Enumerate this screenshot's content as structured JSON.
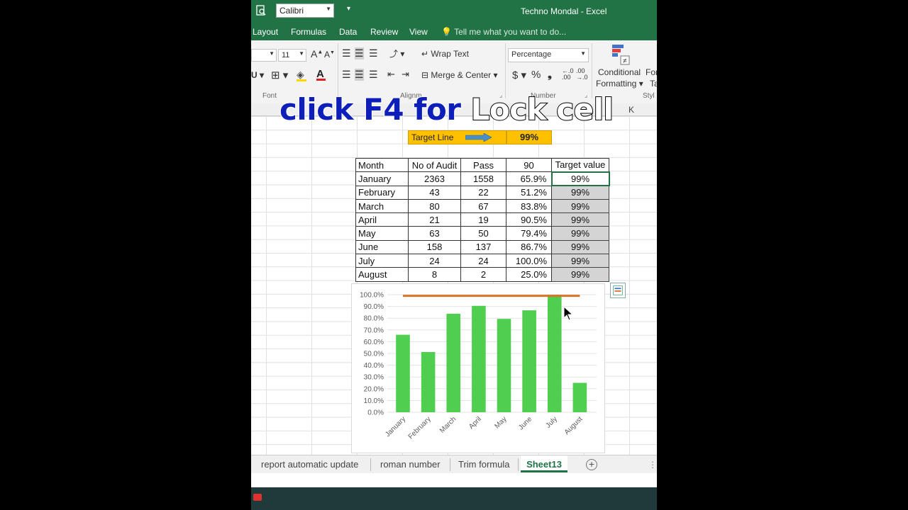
{
  "window": {
    "title": "Techno Mondal - Excel"
  },
  "quick_access": {
    "font_name": "Calibri",
    "more": "▾"
  },
  "menu": {
    "tabs": [
      "Layout",
      "Formulas",
      "Data",
      "Review",
      "View"
    ],
    "tell_me": "Tell me what you want to do..."
  },
  "ribbon": {
    "font_size": "11",
    "wrap_text": "Wrap Text",
    "merge_center": "Merge & Center",
    "number_format": "Percentage",
    "currency": "$",
    "percent": "%",
    "comma": "❟",
    "conditional_formatting_1": "Conditional",
    "conditional_formatting_2": "Formatting",
    "format_as_1": "For",
    "format_as_2": "Ta",
    "font_group": "Font",
    "alignment_group": "Alignm",
    "number_group": "Number",
    "styles_group": "Styl"
  },
  "caption": {
    "part1": "click F4 for",
    "part2": "Lock cell"
  },
  "column_header": "K",
  "target": {
    "label": "Target Line",
    "value": "99%"
  },
  "table": {
    "headers": [
      "Month",
      "No of Audit",
      "Pass",
      "90",
      "Target value"
    ],
    "rows": [
      [
        "January",
        "2363",
        "1558",
        "65.9%",
        "99%"
      ],
      [
        "February",
        "43",
        "22",
        "51.2%",
        "99%"
      ],
      [
        "March",
        "80",
        "67",
        "83.8%",
        "99%"
      ],
      [
        "April",
        "21",
        "19",
        "90.5%",
        "99%"
      ],
      [
        "May",
        "63",
        "50",
        "79.4%",
        "99%"
      ],
      [
        "June",
        "158",
        "137",
        "86.7%",
        "99%"
      ],
      [
        "July",
        "24",
        "24",
        "100.0%",
        "99%"
      ],
      [
        "August",
        "8",
        "2",
        "25.0%",
        "99%"
      ]
    ]
  },
  "chart_data": {
    "type": "bar",
    "categories": [
      "January",
      "February",
      "March",
      "April",
      "May",
      "June",
      "July",
      "August"
    ],
    "series": [
      {
        "values": [
          65.9,
          51.2,
          83.8,
          90.5,
          79.4,
          86.7,
          100.0,
          25.0
        ],
        "color": "#4fce4f"
      },
      {
        "values": [
          99,
          99,
          99,
          99,
          99,
          99,
          99,
          99
        ],
        "color": "#d9742a",
        "kind": "line"
      }
    ],
    "yticks": [
      "0.0%",
      "10.0%",
      "20.0%",
      "30.0%",
      "40.0%",
      "50.0%",
      "60.0%",
      "70.0%",
      "80.0%",
      "90.0%",
      "100.0%"
    ],
    "ylim": [
      0,
      100
    ],
    "grid": true
  },
  "sheet_tabs": [
    "report automatic update",
    "roman number",
    "Trim formula",
    "Sheet13"
  ],
  "active_tab": "Sheet13",
  "add_sheet": "+",
  "tab_more": "⋮"
}
